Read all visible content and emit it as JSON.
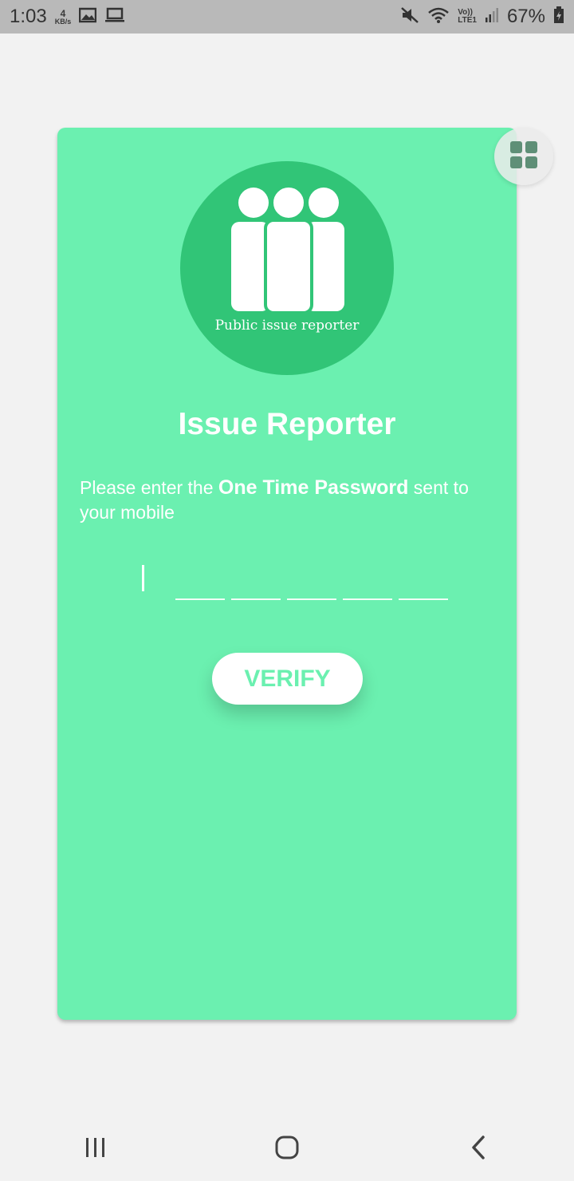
{
  "status_bar": {
    "time": "1:03",
    "net_speed_value": "4",
    "net_speed_unit": "KB/s",
    "lte_top": "Vo))",
    "lte_bottom": "LTE1",
    "battery": "67%"
  },
  "logo": {
    "caption": "Public issue reporter"
  },
  "app": {
    "title": "Issue Reporter",
    "instructions_pre": "Please enter the ",
    "instructions_bold": "One Time Password",
    "instructions_post": " sent to your mobile"
  },
  "otp": {
    "length": 5
  },
  "verify_label": "VERIFY",
  "colors": {
    "card": "#6bf0b0",
    "logo_bg": "#31c577",
    "button_text": "#6bf0b0"
  }
}
